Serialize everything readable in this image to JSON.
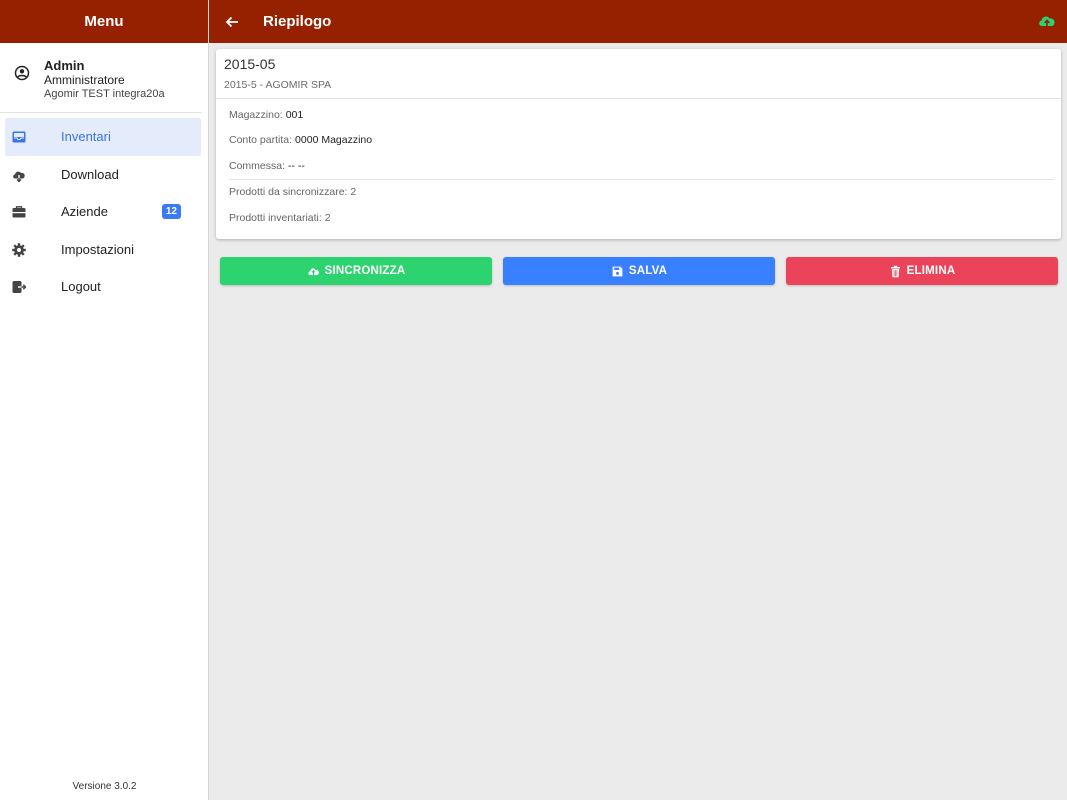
{
  "sidebar": {
    "title": "Menu",
    "user": {
      "name": "Admin",
      "role": "Amministratore",
      "company": "Agomir TEST integra20a"
    },
    "items": [
      {
        "label": "Inventari",
        "icon": "inbox-icon"
      },
      {
        "label": "Download",
        "icon": "cloud-download-icon"
      },
      {
        "label": "Aziende",
        "icon": "briefcase-icon",
        "badge": "12"
      },
      {
        "label": "Impostazioni",
        "icon": "gear-icon"
      },
      {
        "label": "Logout",
        "icon": "logout-icon"
      }
    ],
    "version": "Versione 3.0.2"
  },
  "header": {
    "title": "Riepilogo"
  },
  "card": {
    "title": "2015-05",
    "subtitle": "2015-5 - AGOMIR SPA",
    "magazzino_label": "Magazzino:",
    "magazzino_value": "001",
    "conto_label": "Conto partita:",
    "conto_value": "0000 Magazzino",
    "commessa_label": "Commessa:",
    "commessa_value": "-- --",
    "da_sincronizzare": "Prodotti da sincronizzare: 2",
    "inventariati": "Prodotti inventariati: 2"
  },
  "actions": {
    "sync_label": "SINCRONIZZA",
    "save_label": "SALVA",
    "delete_label": "ELIMINA"
  },
  "colors": {
    "brand": "#952100",
    "sync": "#2dd36f",
    "save": "#3880ff",
    "delete": "#eb445a",
    "active": "#3a72e8"
  }
}
